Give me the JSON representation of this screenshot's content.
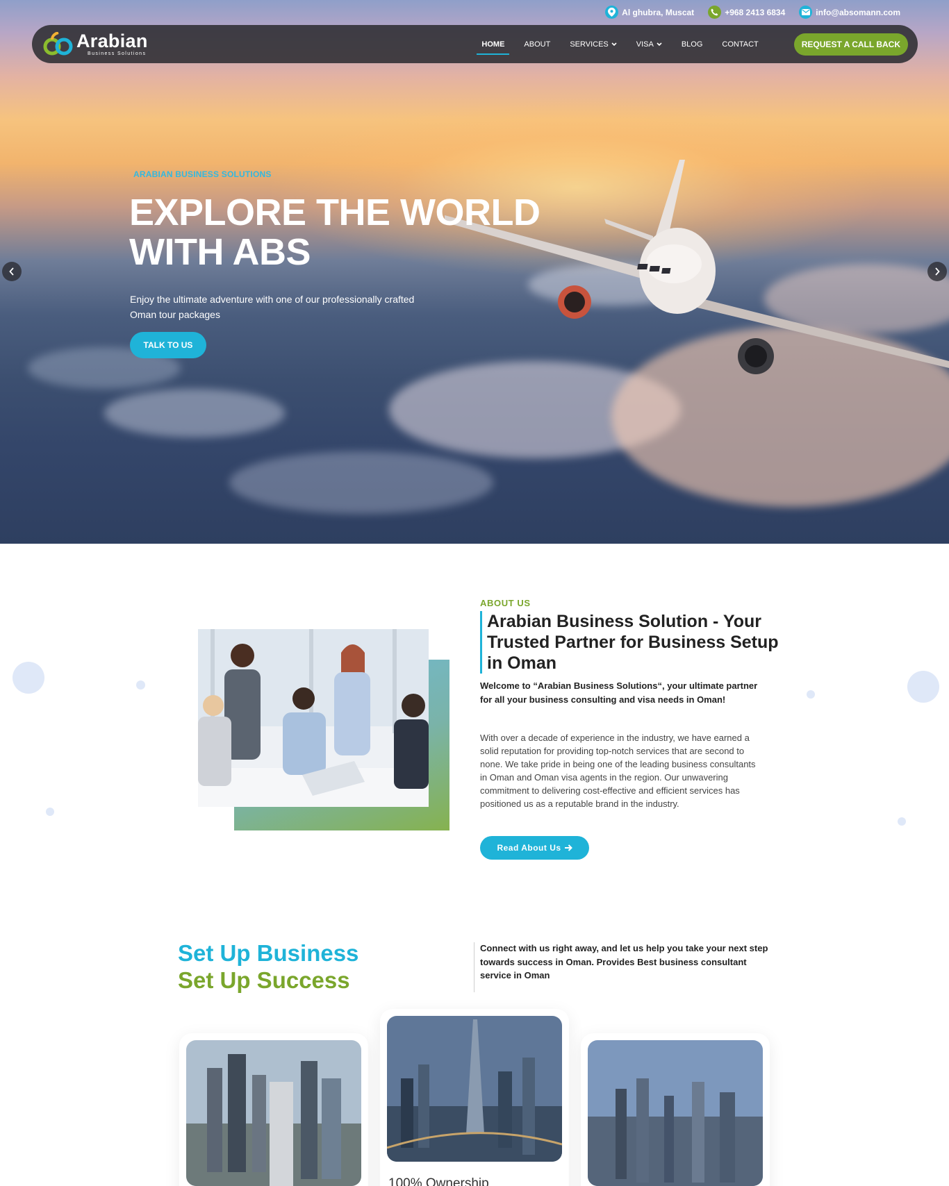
{
  "topbar": {
    "location": "Al ghubra, Muscat",
    "phone": "+968 2413 6834",
    "email": "info@absomann.com"
  },
  "brand": {
    "name": "Arabian",
    "tagline": "Business Solutions"
  },
  "nav": {
    "items": [
      {
        "label": "HOME",
        "active": true
      },
      {
        "label": "ABOUT"
      },
      {
        "label": "SERVICES",
        "dropdown": true
      },
      {
        "label": "VISA",
        "dropdown": true
      },
      {
        "label": "BLOG"
      },
      {
        "label": "CONTACT"
      }
    ],
    "cta": "REQUEST A CALL BACK"
  },
  "hero": {
    "kicker": "ARABIAN BUSINESS SOLUTIONS",
    "title_line1": "EXPLORE THE WORLD",
    "title_line2": "WITH ABS",
    "text": "Enjoy the ultimate adventure with one of our professionally crafted Oman tour packages",
    "button": "TALK TO US"
  },
  "about": {
    "kicker": "ABOUT US",
    "title": "Arabian Business Solution - Your Trusted Partner for Business Setup in Oman",
    "lead": "Welcome to “Arabian Business Solutions“, your ultimate partner for all your business consulting and visa needs in Oman!",
    "body": "With over a decade of experience in the industry, we have earned a solid reputation for providing top-notch services that are second to none. We take pride in being one of the leading business consultants in Oman and Oman visa agents in the region. Our unwavering commitment to delivering cost-effective and efficient services has positioned us as a reputable brand in the industry.",
    "button": "Read About Us"
  },
  "setup": {
    "heading1": "Set Up Business",
    "heading2": "Set Up Success",
    "text": "Connect with us right away, and let us help you take your next step towards success in Oman. Provides Best business consultant service in Oman",
    "cards": [
      {
        "title": ""
      },
      {
        "title": "100% Ownership"
      },
      {
        "title": ""
      }
    ]
  },
  "colors": {
    "primary": "#1fb3d8",
    "accent": "#7aa62c",
    "nav_bg": "#2d2d32"
  }
}
